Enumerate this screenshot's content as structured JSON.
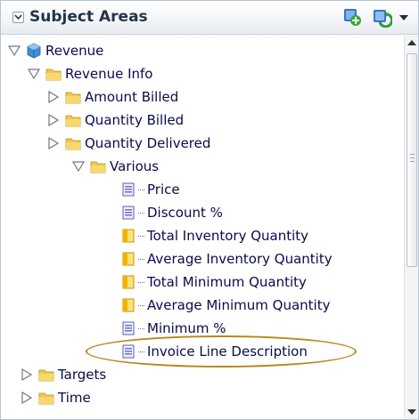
{
  "header": {
    "title": "Subject Areas",
    "icons": [
      "collapse-icon",
      "add-subject-area-icon",
      "refresh-icon",
      "dropdown-caret-icon"
    ]
  },
  "tree": {
    "root": {
      "label": "Revenue",
      "expanded": true,
      "icon": "cube-icon"
    },
    "folders": [
      {
        "label": "Revenue Info",
        "expanded": true
      },
      {
        "label": "Amount Billed",
        "expanded": false
      },
      {
        "label": "Quantity Billed",
        "expanded": false
      },
      {
        "label": "Quantity Delivered",
        "expanded": false
      },
      {
        "label": "Various",
        "expanded": true
      },
      {
        "label": "Targets",
        "expanded": false
      },
      {
        "label": "Time",
        "expanded": false
      }
    ],
    "columns": [
      {
        "label": "Price",
        "kind": "attribute"
      },
      {
        "label": "Discount %",
        "kind": "attribute"
      },
      {
        "label": "Total Inventory Quantity",
        "kind": "measure"
      },
      {
        "label": "Average Inventory Quantity",
        "kind": "measure"
      },
      {
        "label": "Total Minimum Quantity",
        "kind": "measure"
      },
      {
        "label": "Average Minimum Quantity",
        "kind": "measure"
      },
      {
        "label": "Minimum %",
        "kind": "attribute"
      },
      {
        "label": "Invoice Line Description",
        "kind": "attribute"
      }
    ],
    "highlighted_item": "Invoice Line Description"
  },
  "colors": {
    "label_text": "#0a0a4e",
    "folder": "#f2c84b",
    "attribute_icon": "#6f72c8",
    "measure_icon": "#f0b400",
    "highlight_oval": "#b8861a"
  }
}
